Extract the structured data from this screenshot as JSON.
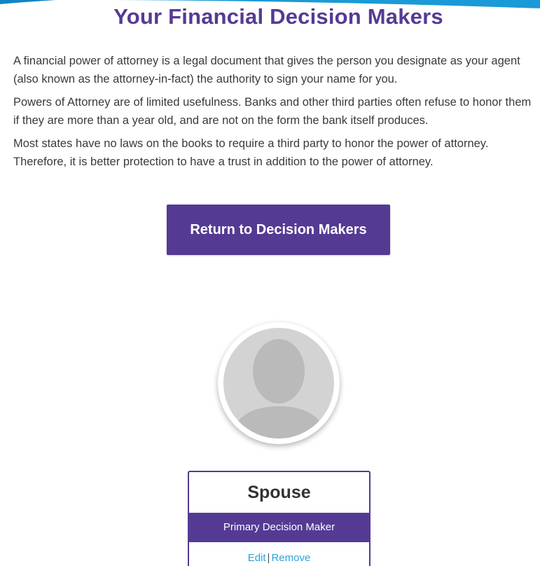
{
  "page": {
    "title": "Your Financial Decision Makers"
  },
  "intro": {
    "paragraphs": [
      "A financial power of attorney is a legal document that gives the person you designate as your agent (also known as the attorney-in-fact) the authority to sign your name for you.",
      "Powers of Attorney are of limited usefulness. Banks and other third parties often refuse to honor them if they are more than a year old, and are not on the form the bank itself produces.",
      "Most states have no laws on the books to require a third party to honor the power of attorney. Therefore, it is better protection to have a trust in addition to the power of attorney."
    ]
  },
  "actions": {
    "return_label": "Return to Decision Makers"
  },
  "decision_maker": {
    "avatar_icon": "person-silhouette-icon",
    "name": "Spouse",
    "role": "Primary Decision Maker",
    "edit_label": "Edit",
    "separator": "|",
    "remove_label": "Remove"
  },
  "colors": {
    "brand_purple": "#553a93",
    "link_blue": "#2aa4d6",
    "top_wave_blue": "#1a9ad6"
  }
}
